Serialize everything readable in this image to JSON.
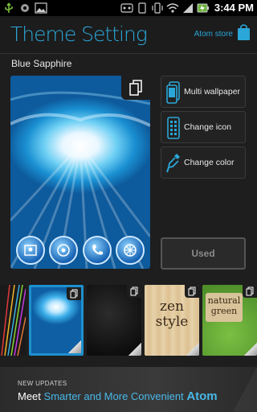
{
  "status_bar": {
    "time": "3:44 PM",
    "left_icons": [
      "usb-icon",
      "android-debug-icon",
      "gallery-notification-icon"
    ],
    "right_icons": [
      "game-controller-icon",
      "phone-icon",
      "vibrate-icon",
      "wifi-icon",
      "signal-icon",
      "battery-charging-icon"
    ]
  },
  "header": {
    "title": "Theme Setting",
    "store_label": "Atom store"
  },
  "theme": {
    "name": "Blue Sapphire"
  },
  "options": [
    {
      "label": "Multi wallpaper",
      "icon": "multi-wallpaper-icon"
    },
    {
      "label": "Change icon",
      "icon": "change-icon-icon"
    },
    {
      "label": "Change color",
      "icon": "color-dropper-icon"
    }
  ],
  "used_button": {
    "label": "Used"
  },
  "gallery": {
    "thumbnails": [
      {
        "id": "thumb-colorful-lines"
      },
      {
        "id": "thumb-blue-sapphire",
        "selected": true
      },
      {
        "id": "thumb-black-leather"
      },
      {
        "id": "thumb-zen-style",
        "text": "zen style"
      },
      {
        "id": "thumb-natural-green",
        "text": "natural green"
      }
    ]
  },
  "banner": {
    "small_text": "NEW UPDATES",
    "meet": "Meet",
    "tagline": "Smarter and More Convenient",
    "brand": "Atom"
  },
  "colors": {
    "accent": "#2aa7d8",
    "background": "#1e1e1e",
    "selected_border": "#1e90d0"
  }
}
